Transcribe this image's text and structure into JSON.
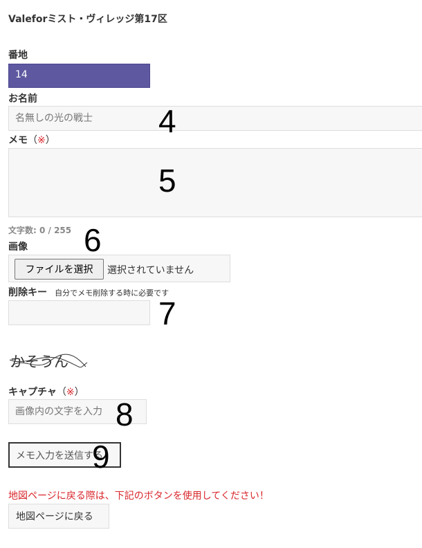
{
  "page_title": "Valeforミスト・ヴィレッジ第17区",
  "fields": {
    "plot": {
      "label": "番地",
      "value": "14"
    },
    "name": {
      "label": "お名前",
      "placeholder": "名無しの光の戦士"
    },
    "memo": {
      "label": "メモ",
      "paren_open": "（",
      "required_mark": "※",
      "paren_close": "）",
      "counter": "文字数: 0 / 255"
    },
    "image": {
      "label": "画像",
      "button_label": "ファイルを選択",
      "no_file_text": "選択されていません"
    },
    "delete_key": {
      "label": "削除キー",
      "hint": "自分でメモ削除する時に必要です"
    },
    "captcha": {
      "image_text": "かそうん",
      "label": "キャプチャ",
      "paren_open": "（",
      "required_mark": "※",
      "paren_close": "）",
      "placeholder": "画像内の文字を入力"
    }
  },
  "submit": {
    "label": "メモ入力を送信する"
  },
  "back": {
    "warning": "地図ページに戻る際は、下記のボタンを使用してください！",
    "label": "地図ページに戻る"
  },
  "annotations": [
    "4",
    "5",
    "6",
    "7",
    "8",
    "9"
  ],
  "colors": {
    "select_bg": "#5e58a0",
    "required": "#d9262b",
    "field_bg": "#f7f7f7"
  }
}
